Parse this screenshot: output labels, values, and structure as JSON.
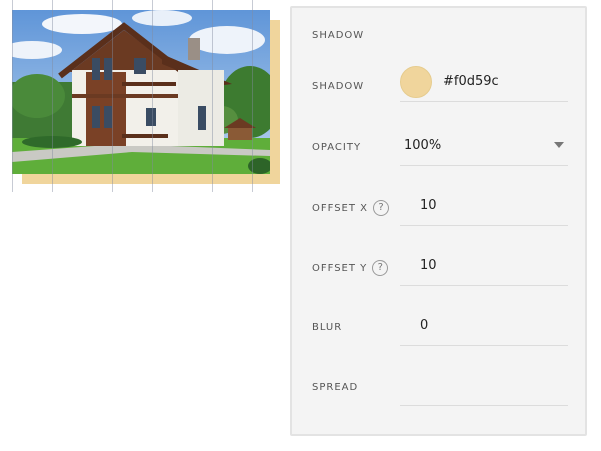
{
  "preview": {
    "shadow_color": "#f0d59c",
    "image": "two-storey-house-photo"
  },
  "panel": {
    "section_title": "SHADOW",
    "shadow": {
      "label": "SHADOW",
      "color_value": "#f0d59c",
      "swatch_color": "#f0d59c"
    },
    "opacity": {
      "label": "OPACITY",
      "value": "100%",
      "icon": "chevron-down-icon"
    },
    "offset_x": {
      "label": "OFFSET X",
      "help": "?",
      "value": "10"
    },
    "offset_y": {
      "label": "OFFSET Y",
      "help": "?",
      "value": "10"
    },
    "blur": {
      "label": "BLUR",
      "value": "0"
    },
    "spread": {
      "label": "SPREAD",
      "value": ""
    }
  }
}
